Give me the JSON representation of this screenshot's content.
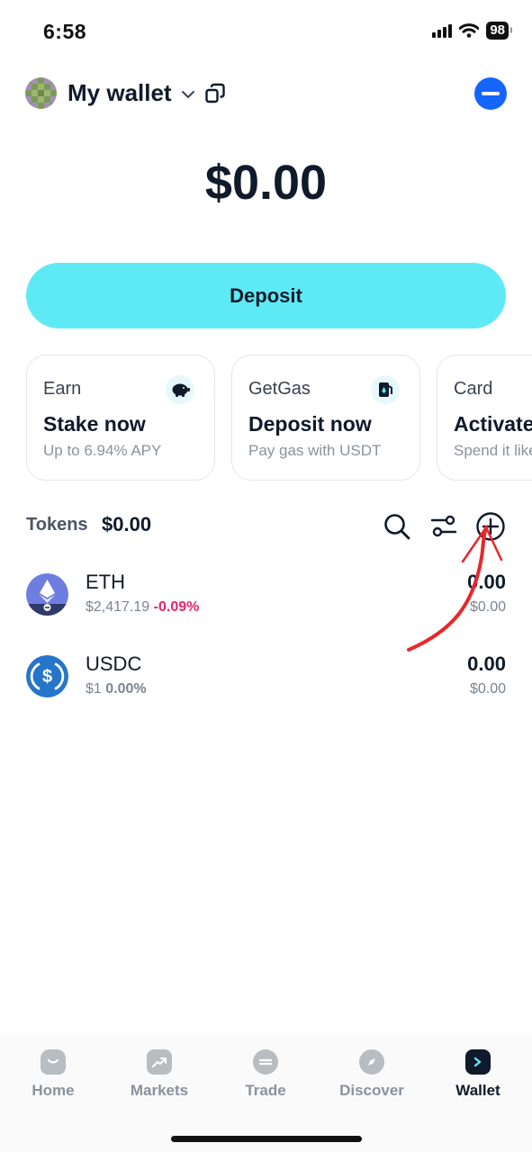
{
  "status_bar": {
    "time": "6:58",
    "battery": "98"
  },
  "header": {
    "wallet_name": "My wallet"
  },
  "balance": "$0.00",
  "deposit_label": "Deposit",
  "cards": [
    {
      "category": "Earn",
      "title": "Stake now",
      "subtitle": "Up to 6.94% APY",
      "icon": "piggy-bank-icon"
    },
    {
      "category": "GetGas",
      "title": "Deposit now",
      "subtitle": "Pay gas with USDT",
      "icon": "gas-pump-icon"
    },
    {
      "category": "Card",
      "title": "Activate",
      "subtitle": "Spend it like cash",
      "icon": "card-icon"
    }
  ],
  "tokens": {
    "label": "Tokens",
    "total": "$0.00",
    "items": [
      {
        "symbol": "ETH",
        "price": "$2,417.19",
        "change": "-0.09%",
        "amount": "0.00",
        "value": "$0.00",
        "change_color": "#e5256b"
      },
      {
        "symbol": "USDC",
        "price": "$1",
        "change": "0.00%",
        "amount": "0.00",
        "value": "$0.00",
        "change_color": "#7b8490"
      }
    ]
  },
  "nav": {
    "items": [
      {
        "label": "Home",
        "icon": "home-icon"
      },
      {
        "label": "Markets",
        "icon": "markets-icon"
      },
      {
        "label": "Trade",
        "icon": "trade-icon"
      },
      {
        "label": "Discover",
        "icon": "compass-icon"
      },
      {
        "label": "Wallet",
        "icon": "wallet-icon"
      }
    ],
    "active": "Wallet"
  },
  "colors": {
    "accent": "#5eeaf4",
    "primary_blue": "#1565ff",
    "negative": "#e5256b",
    "annotation": "#e8272c"
  }
}
